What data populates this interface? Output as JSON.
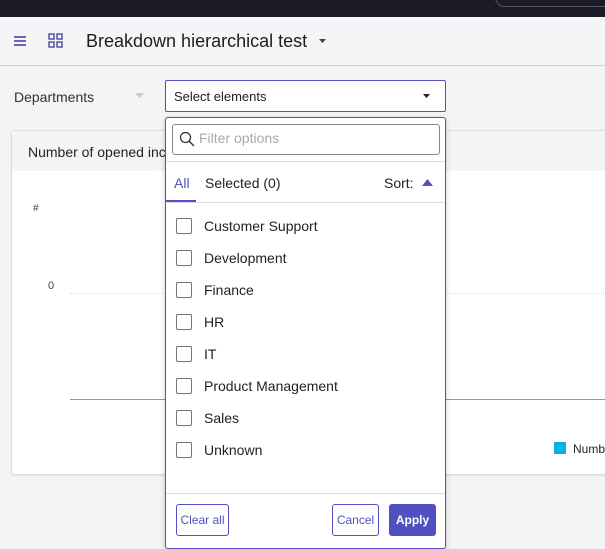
{
  "header": {
    "title": "Breakdown hierarchical test"
  },
  "filter": {
    "label": "Departments",
    "select_placeholder": "Select elements"
  },
  "card": {
    "title": "Number of opened inci",
    "y_axis_label": "#",
    "y_tick": "0",
    "legend_label": "Numb",
    "legend_color": "#00b4d8"
  },
  "dropdown": {
    "filter_placeholder": "Filter options",
    "tabs": [
      {
        "label": "All",
        "active": true
      },
      {
        "label": "Selected (0)",
        "active": false
      }
    ],
    "sort_label": "Sort:",
    "sort_direction": "ascending",
    "items": [
      {
        "label": "Customer Support",
        "checked": false
      },
      {
        "label": "Development",
        "checked": false
      },
      {
        "label": "Finance",
        "checked": false
      },
      {
        "label": "HR",
        "checked": false
      },
      {
        "label": "IT",
        "checked": false
      },
      {
        "label": "Product Management",
        "checked": false
      },
      {
        "label": "Sales",
        "checked": false
      },
      {
        "label": "Unknown",
        "checked": false
      }
    ],
    "clear_label": "Clear all",
    "cancel_label": "Cancel",
    "apply_label": "Apply"
  },
  "colors": {
    "accent": "#5050c0",
    "topbar": "#1b1a27"
  }
}
